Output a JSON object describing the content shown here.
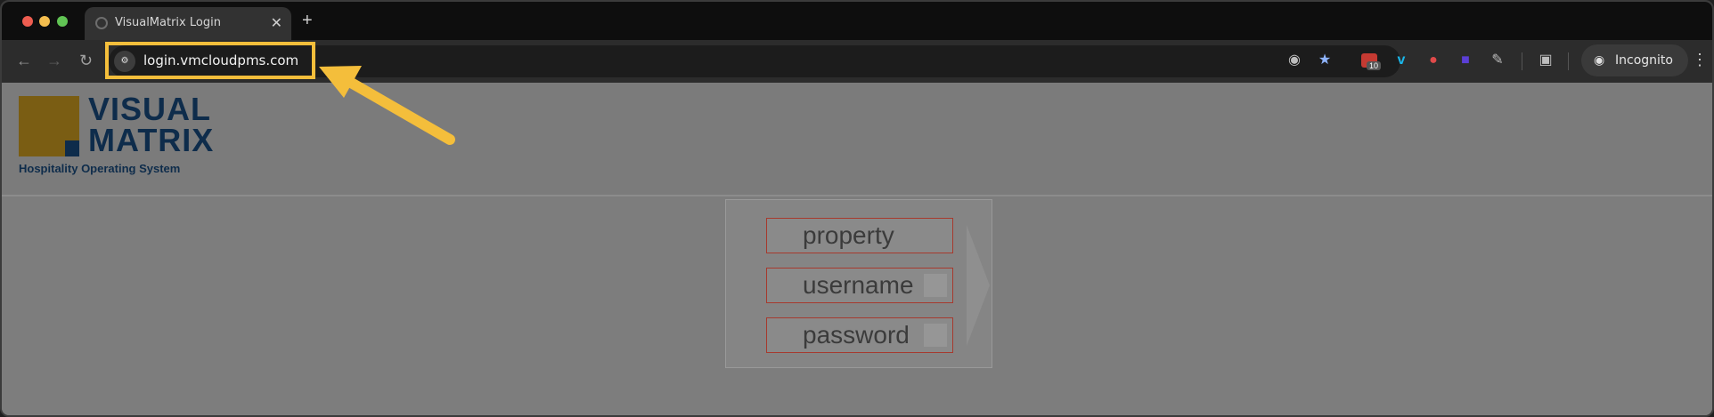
{
  "browser": {
    "tab_title": "VisualMatrix Login",
    "tab_close": "✕",
    "new_tab": "+",
    "url": "login.vmcloudpms.com",
    "extension_badge": "10",
    "incognito_label": "Incognito",
    "icons": [
      "back-icon",
      "forward-icon",
      "reload-icon",
      "site-info-icon",
      "eye-off-icon",
      "star-icon",
      "calendar-extension-icon",
      "vimeo-extension-icon",
      "red-extension-icon",
      "purple-extension-icon",
      "extensions-puzzle-icon",
      "tab-search-icon",
      "incognito-icon",
      "menu-icon"
    ]
  },
  "logo": {
    "line1": "VISUAL",
    "line2": "MATRIX",
    "tagline": "Hospitality Operating System",
    "colors": {
      "gold": "#7a5d13",
      "navy": "#0e2c4b"
    }
  },
  "login": {
    "property_placeholder": "property",
    "username_placeholder": "username",
    "password_placeholder": "password"
  },
  "annotation": {
    "highlight_color": "#f4be3b"
  }
}
